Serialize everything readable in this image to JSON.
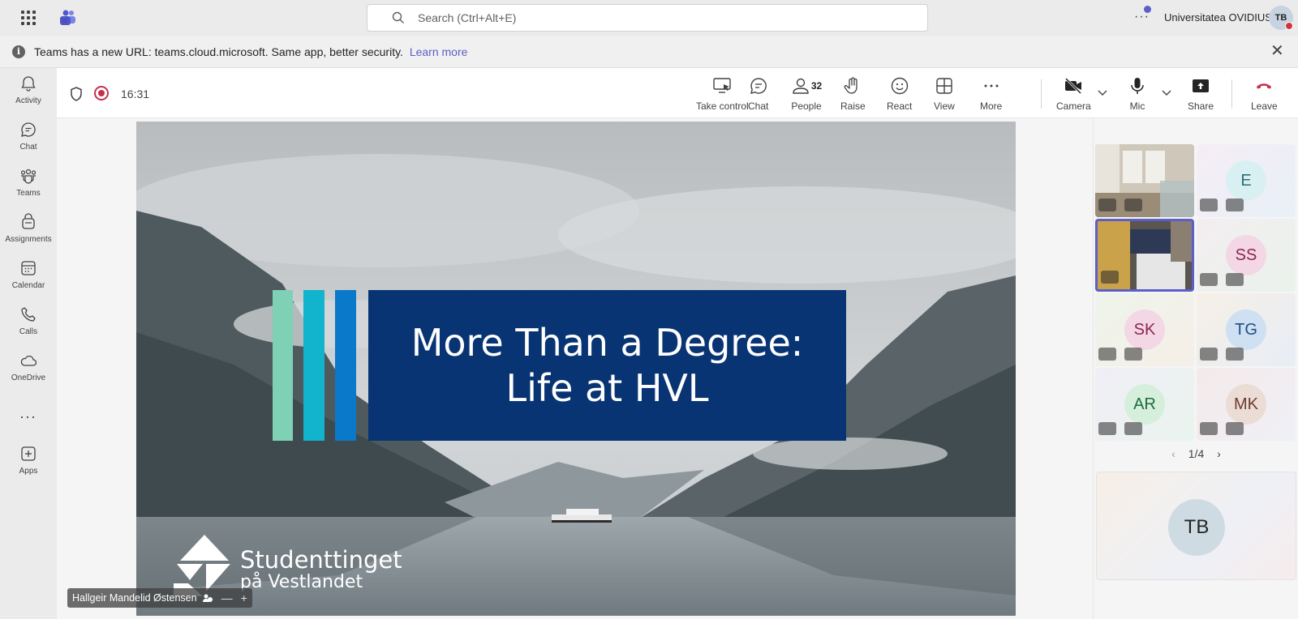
{
  "topbar": {
    "search_placeholder": "Search (Ctrl+Alt+E)",
    "more": "···",
    "org_name": "Universitatea OVIDIUS",
    "user_initials": "TB"
  },
  "banner": {
    "message": "Teams has a new URL: teams.cloud.microsoft. Same app, better security.",
    "link": "Learn more",
    "close": "✕"
  },
  "rail": {
    "items": [
      {
        "label": "Activity",
        "icon": "bell-icon"
      },
      {
        "label": "Chat",
        "icon": "chat-icon"
      },
      {
        "label": "Teams",
        "icon": "teams-icon"
      },
      {
        "label": "Assignments",
        "icon": "assignments-icon"
      },
      {
        "label": "Calendar",
        "icon": "calendar-icon"
      },
      {
        "label": "Calls",
        "icon": "phone-icon"
      },
      {
        "label": "OneDrive",
        "icon": "cloud-icon"
      },
      {
        "label": "Apps",
        "icon": "plus-box-icon"
      }
    ],
    "more": "···"
  },
  "meeting": {
    "timer": "16:31",
    "toolbar": {
      "take_control": "Take control",
      "chat": "Chat",
      "people": "People",
      "people_count": "32",
      "raise": "Raise",
      "react": "React",
      "view": "View",
      "more": "More",
      "camera": "Camera",
      "mic": "Mic",
      "share": "Share",
      "leave": "Leave"
    },
    "slide": {
      "title": "More Than a Degree: Life at HVL",
      "logo_line1": "Studenttinget",
      "logo_line2": "på Vestlandet"
    },
    "presenter": {
      "name": "Hallgeir Mandelid Østensen",
      "minus": "—",
      "plus": "+"
    },
    "participants": [
      {
        "initials": "",
        "video": true
      },
      {
        "initials": "E",
        "video": false
      },
      {
        "initials": "",
        "video": true,
        "active": true
      },
      {
        "initials": "SS",
        "video": false
      },
      {
        "initials": "SK",
        "video": false
      },
      {
        "initials": "TG",
        "video": false
      },
      {
        "initials": "AR",
        "video": false
      },
      {
        "initials": "MK",
        "video": false
      }
    ],
    "pager": {
      "prev": "‹",
      "label": "1/4",
      "next": "›"
    },
    "self_initials": "TB",
    "colors": {
      "accent": "#5b5fc7",
      "leave": "#c4314b",
      "slide_box": "#093473"
    }
  }
}
